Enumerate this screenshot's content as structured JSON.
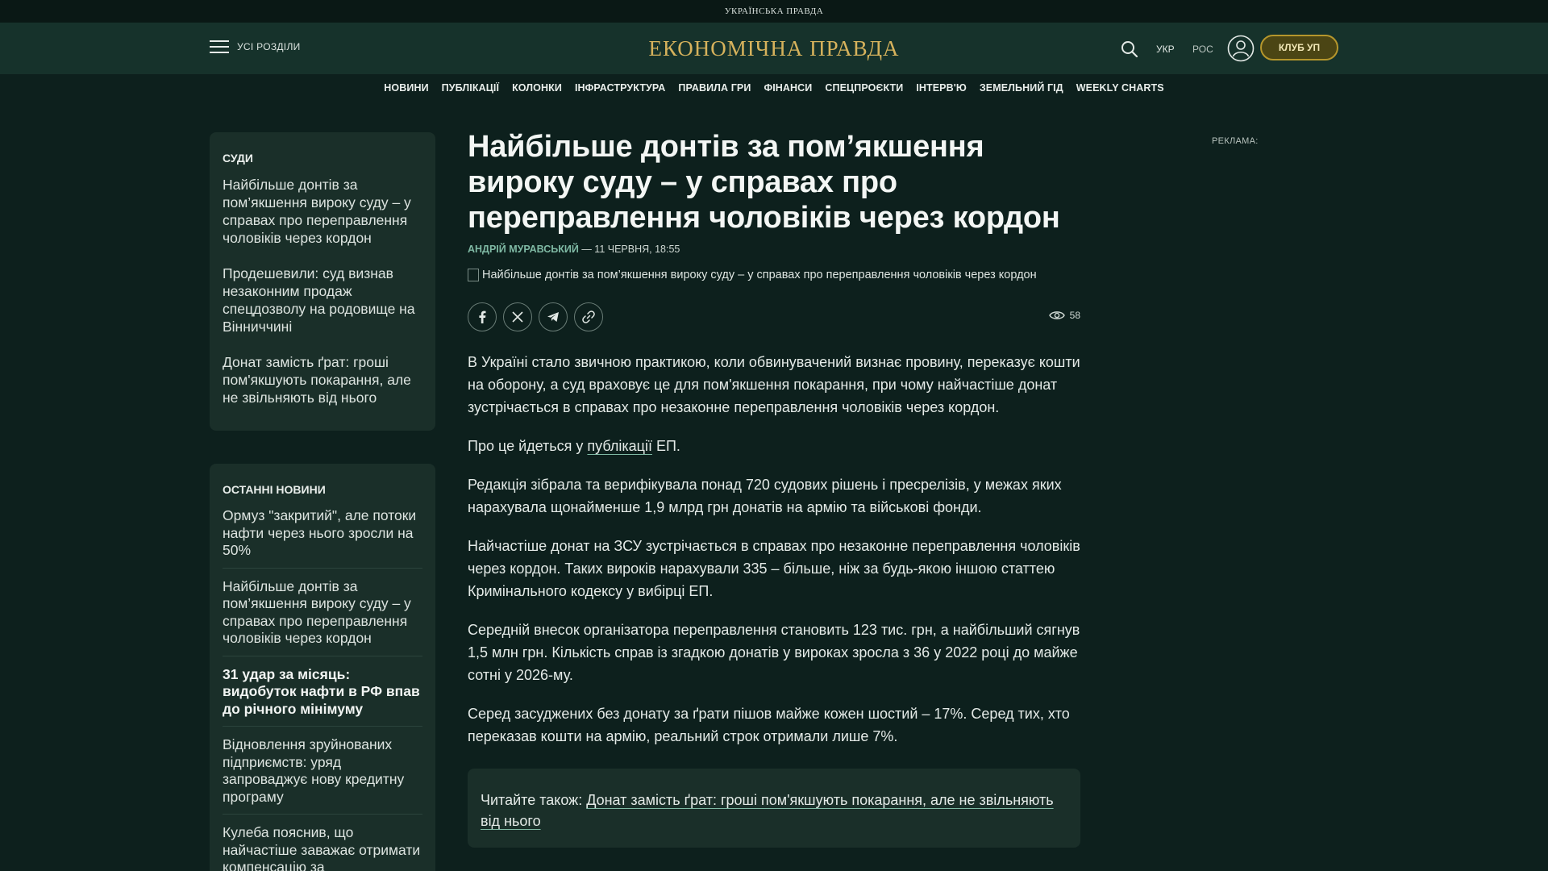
{
  "topbar": {
    "brand": "УКРАЇНСЬКА ПРАВДА"
  },
  "header": {
    "menu_label": "УСІ РОЗДІЛИ",
    "logo": "ЕКОНОМІЧНА ПРАВДА",
    "lang_ukr": "УКР",
    "lang_ros": "РОС",
    "club_label": "КЛУБ УП",
    "accent_color": "#d6b25c"
  },
  "nav": {
    "items": [
      "НОВИНИ",
      "ПУБЛІКАЦІЇ",
      "КОЛОНКИ",
      "ІНФРАСТРУКТУРА",
      "ПРАВИЛА ГРИ",
      "ФІНАНСИ",
      "СПЕЦПРОЄКТИ",
      "ІНТЕРВ'Ю",
      "ЗЕМЕЛЬНИЙ ГІД",
      "WEEKLY CHARTS"
    ]
  },
  "sidebar": {
    "judges_title": "СУДИ",
    "judges_links": [
      "Найбільше донтів за пом’якшення вироку суду – у справах про переправлення чоловіків через кордон",
      "Продешевили: суд визнав незаконним продаж спецдозволу на родовище на Вінниччині",
      "Донат замість ґрат: гроші пом'якшують покарання, але не звільняють від нього"
    ],
    "latest_title": "ОСТАННІ НОВИНИ",
    "latest_links": [
      "Ормуз \"закритий\", але потоки нафти через нього зросли на 50%",
      "Найбільше донтів за пом’якшення вироку суду – у справах про переправлення чоловіків через кордон",
      "31 удар за місяць: видобуток нафти в РФ впав до річного мінімуму",
      "Відновлення зруйнованих підприємств: уряд запроваджує нову кредитну програму",
      "Кулеба пояснив, що найчастіше заважає отримати компенсацію за"
    ]
  },
  "article": {
    "headline": "Найбільше донтів за пом’якшення вироку суду – у справах про переправлення чоловіків через кордон",
    "author": "АНДРІЙ МУРАВСЬКИЙ",
    "date": " — 11 ЧЕРВНЯ, 18:55",
    "image_alt": "Найбільше донтів за пом’якшення вироку суду – у справах про переправлення чоловіків через кордон",
    "views": "58",
    "p1": "В Україні стало звичною практикою, коли обвинувачений визнає провину, переказує кошти на оборону, а суд враховує це для пом'якшення покарання, при чому найчастіше донат зустрічається в справах про незаконне переправлення чоловіків через кордон.",
    "p2_prefix": "Про це йдеться у ",
    "p2_link": "публікації",
    "p2_suffix": " ЕП.",
    "p3": "Редакція зібрала та верифікувала понад 720 судових рішень і пресрелізів, у межах яких нарахувала щонайменше 1,9 млрд грн донатів на армію та військові фонди.",
    "p4": "Найчастіше донат на ЗСУ зустрічається в справах про незаконне переправлення чоловіків через кордон. Таких вироків нарахували 335 – більше, ніж за будь-якою іншою статтею Кримінального кодексу у вибірці ЕП.",
    "p5": "Середній внесок організатора переправлення становить 123 тис. грн, а найбільший сягнув 1,5 млн грн. Кількість справ із згадкою донатів у вироках зросла з 36 у 2022 році до майже сотні у 2026-му.",
    "p6": "Серед засуджених без донату за ґрати пішов майже кожен шостий – 17%. Серед тих, хто переказав кошти на армію, реальний строк отримали лише 7%.",
    "read_also_prefix": "Читайте також: ",
    "read_also_link": "Донат замість ґрат: гроші пом'якшують покарання, але не звільняють від нього"
  },
  "ad": {
    "label": "РЕКЛАМА:"
  }
}
